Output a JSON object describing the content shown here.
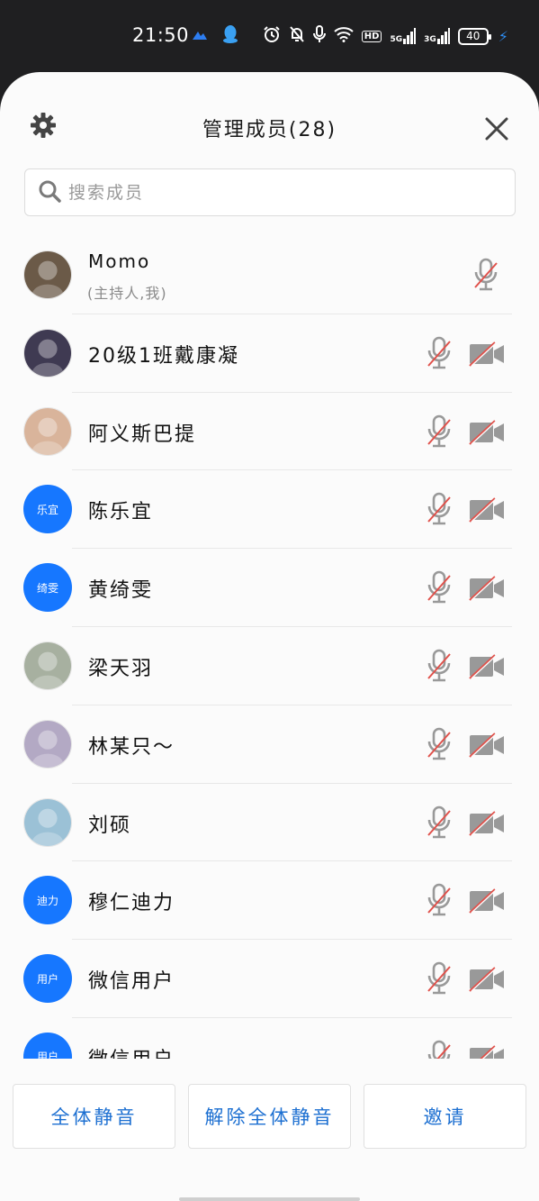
{
  "status_bar": {
    "time": "21:50",
    "hd_label": "HD",
    "net1": "5G",
    "net2": "3G",
    "battery": "40"
  },
  "sheet": {
    "title": "管理成员(28)",
    "search_placeholder": "搜索成员"
  },
  "members": [
    {
      "name": "Momo",
      "sub": "(主持人,我)",
      "avatar_type": "photo",
      "photo_color": "#6b5a48",
      "host": true
    },
    {
      "name": "20级1班戴康凝",
      "avatar_type": "photo",
      "photo_color": "#3f3a52"
    },
    {
      "name": "阿义斯巴提",
      "avatar_type": "photo",
      "photo_color": "#d9b49b"
    },
    {
      "name": "陈乐宜",
      "avatar_type": "initials",
      "initials": "乐宜"
    },
    {
      "name": "黄绮雯",
      "avatar_type": "initials",
      "initials": "绮雯"
    },
    {
      "name": "梁天羽",
      "avatar_type": "photo",
      "photo_color": "#a7b0a0"
    },
    {
      "name": "林某只～",
      "avatar_type": "photo",
      "photo_color": "#b3a9c4"
    },
    {
      "name": "刘硕",
      "avatar_type": "photo",
      "photo_color": "#9bc1d6"
    },
    {
      "name": "穆仁迪力",
      "avatar_type": "initials",
      "initials": "迪力"
    },
    {
      "name": "微信用户",
      "avatar_type": "initials",
      "initials": "用户"
    },
    {
      "name": "微信用户",
      "avatar_type": "initials",
      "initials": "用户"
    }
  ],
  "footer": {
    "mute_all": "全体静音",
    "unmute_all": "解除全体静音",
    "invite": "邀请"
  },
  "colors": {
    "accent_blue": "#1677ff",
    "button_text": "#1c6fd1",
    "muted_red": "#e0514b",
    "icon_gray": "#999999"
  }
}
